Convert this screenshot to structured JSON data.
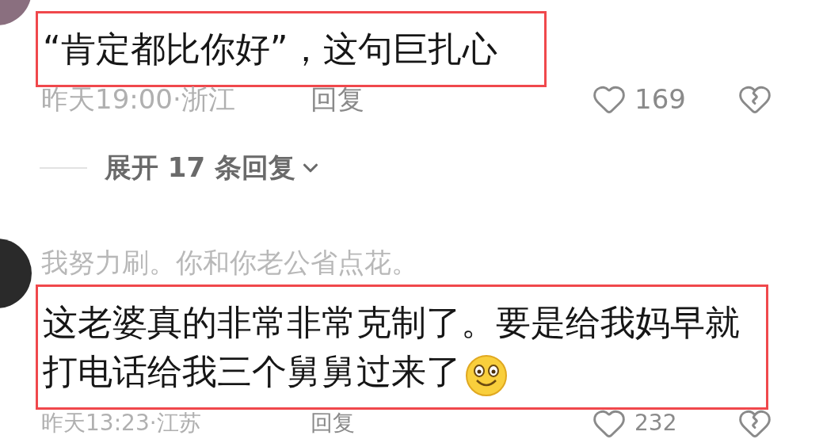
{
  "comments": [
    {
      "text": "“肯定都比你好”，这句巨扎心",
      "highlighted": true,
      "emoji": false,
      "time_location": "昨天19:00·浙江",
      "reply": "回复",
      "likes": "169",
      "expand_replies": "展开 17 条回复"
    },
    {
      "username": "我努力刷。你和你老公省点花。",
      "text": "这老婆真的非常非常克制了。要是给我妈早就打电话给我三个舅舅过来了",
      "highlighted": true,
      "emoji": true,
      "time_location": "昨天13:23·江苏",
      "reply": "回复",
      "likes": "232"
    }
  ]
}
